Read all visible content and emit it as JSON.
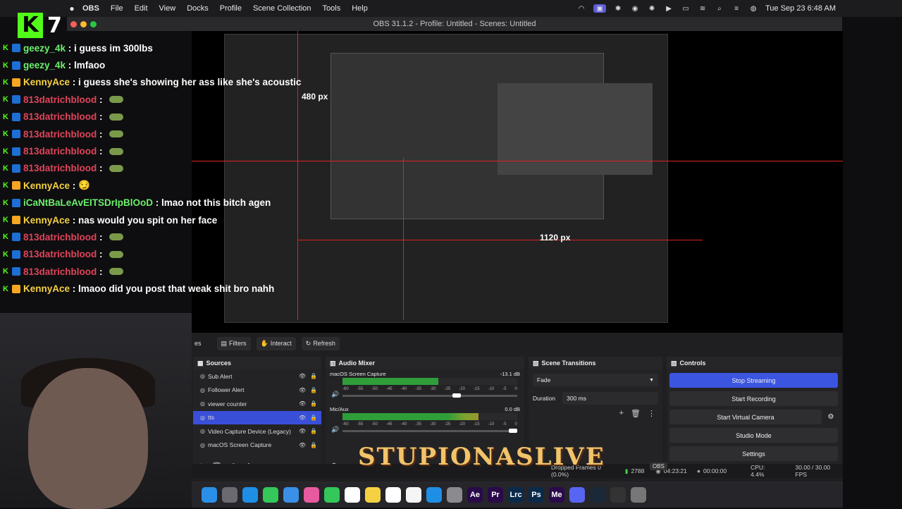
{
  "menubar": {
    "app": "OBS",
    "menus": [
      "File",
      "Edit",
      "View",
      "Docks",
      "Profile",
      "Scene Collection",
      "Tools",
      "Help"
    ],
    "clock": "Tue Sep 23  6:48 AM"
  },
  "window_title": "OBS 31.1.2 - Profile: Untitled - Scenes: Untitled",
  "kick": {
    "viewer_count": "7"
  },
  "chat": [
    {
      "user": "geezy_4k",
      "sep": " : ",
      "text": "i guess im 300lbs",
      "color": "green",
      "kind": "text"
    },
    {
      "user": "geezy_4k",
      "sep": " : ",
      "text": "lmfaoo",
      "color": "green",
      "kind": "text"
    },
    {
      "user": "KennyAce",
      "sep": " : ",
      "text": "i guess she's showing her ass like she's acoustic",
      "color": "yellow",
      "kind": "text"
    },
    {
      "user": "813datrichblood",
      "sep": " : ",
      "text": "",
      "color": "red",
      "kind": "emote"
    },
    {
      "user": "813datrichblood",
      "sep": " : ",
      "text": "",
      "color": "red",
      "kind": "emote"
    },
    {
      "user": "813datrichblood",
      "sep": " : ",
      "text": "",
      "color": "red",
      "kind": "emote"
    },
    {
      "user": "813datrichblood",
      "sep": " : ",
      "text": "",
      "color": "red",
      "kind": "emote"
    },
    {
      "user": "813datrichblood",
      "sep": " : ",
      "text": "",
      "color": "red",
      "kind": "emote"
    },
    {
      "user": "KennyAce",
      "sep": " : ",
      "text": "😏",
      "color": "yellow",
      "kind": "text"
    },
    {
      "user": "iCaNtBaLeAvEITSDrIpBlOoD",
      "sep": " : ",
      "text": "lmao not this bitch agen",
      "color": "green",
      "kind": "text"
    },
    {
      "user": "KennyAce",
      "sep": " : ",
      "text": "nas would you spit on her face",
      "color": "yellow",
      "kind": "text"
    },
    {
      "user": "813datrichblood",
      "sep": " : ",
      "text": "",
      "color": "red",
      "kind": "emote"
    },
    {
      "user": "813datrichblood",
      "sep": " : ",
      "text": "",
      "color": "red",
      "kind": "emote"
    },
    {
      "user": "813datrichblood",
      "sep": " : ",
      "text": "",
      "color": "red",
      "kind": "emote"
    },
    {
      "user": "KennyAce",
      "sep": " : ",
      "text": "lmaoo did you post that weak shit bro nahh",
      "color": "yellow",
      "kind": "text"
    }
  ],
  "preview": {
    "label_480": "480 px",
    "label_1120": "1120 px"
  },
  "toolbar": {
    "tab_cut": "es",
    "filters": "Filters",
    "interact": "Interact",
    "refresh": "Refresh"
  },
  "sources": {
    "title": "Sources",
    "items": [
      "Sub Alert",
      "Follower Alert",
      "viewer counter",
      "tts",
      "Video Capture Device (Legacy)",
      "macOS Screen Capture"
    ]
  },
  "mixer": {
    "title": "Audio Mixer",
    "tracks": [
      {
        "name": "macOS Screen Capture",
        "db": "-13.1 dB",
        "level": 0.55,
        "fader": 0.66
      },
      {
        "name": "Mic/Aux",
        "db": "0.0 dB",
        "level": 0.78,
        "fader": 1.0
      }
    ],
    "scale": [
      "-60",
      "-55",
      "-50",
      "-45",
      "-40",
      "-35",
      "-30",
      "-25",
      "-20",
      "-15",
      "-10",
      "-5",
      "0"
    ]
  },
  "transitions": {
    "title": "Scene Transitions",
    "type": "Fade",
    "duration_label": "Duration",
    "duration": "300 ms"
  },
  "controls": {
    "title": "Controls",
    "stop_streaming": "Stop Streaming",
    "start_recording": "Start Recording",
    "start_virtual": "Start Virtual Camera",
    "studio_mode": "Studio Mode",
    "settings": "Settings"
  },
  "status": {
    "dropped": "Dropped Frames 0 (0.0%)",
    "bitrate": "2788",
    "stream_time": "04:23:21",
    "rec_time": "00:00:00",
    "cpu": "CPU: 4.4%",
    "fps": "30.00 / 30.00 FPS"
  },
  "watermark": "STUPIONASLIVE",
  "dock_tooltip": "OBS",
  "dock": [
    "Finder",
    "Launchpad",
    "Safari",
    "Messages",
    "Mail",
    "Photos",
    "FaceTime",
    "Calendar",
    "Notes",
    "Reminders",
    "Freeform",
    "App Store",
    "Settings",
    "Ae",
    "Pr",
    "Lrc",
    "Ps",
    "Me",
    "Discord",
    "Steam",
    "OBS",
    "Trash"
  ],
  "colors": {
    "accent": "#3b55e0",
    "kick_green": "#53fc18",
    "meter_green": "#2f9e3a"
  }
}
